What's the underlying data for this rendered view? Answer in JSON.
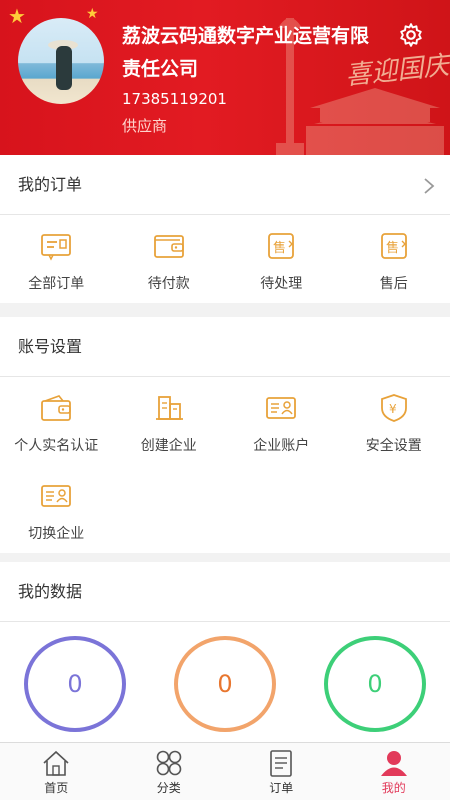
{
  "profile": {
    "company": "荔波云码通数字产业运营有限责任公司",
    "phone": "17385119201",
    "role": "供应商",
    "banner_text": "喜迎国庆"
  },
  "orders": {
    "title": "我的订单",
    "items": [
      {
        "label": "全部订单",
        "icon": "order-list-icon"
      },
      {
        "label": "待付款",
        "icon": "wallet-icon"
      },
      {
        "label": "待处理",
        "icon": "sell-pending-icon"
      },
      {
        "label": "售后",
        "icon": "after-sale-icon"
      }
    ]
  },
  "account": {
    "title": "账号设置",
    "items": [
      {
        "label": "个人实名认证",
        "icon": "wallet-id-icon"
      },
      {
        "label": "创建企业",
        "icon": "building-icon"
      },
      {
        "label": "企业账户",
        "icon": "id-card-icon"
      },
      {
        "label": "安全设置",
        "icon": "shield-yen-icon"
      },
      {
        "label": "切换企业",
        "icon": "id-card-icon"
      }
    ]
  },
  "my_data": {
    "title": "我的数据",
    "items": [
      {
        "value": "0",
        "color": "#7b74d8"
      },
      {
        "value": "0",
        "color": "#f2a46b"
      },
      {
        "value": "0",
        "color": "#3dcf78"
      }
    ]
  },
  "tabbar": {
    "items": [
      {
        "label": "首页",
        "icon": "home-icon"
      },
      {
        "label": "分类",
        "icon": "category-icon"
      },
      {
        "label": "订单",
        "icon": "order-icon"
      },
      {
        "label": "我的",
        "icon": "user-icon",
        "active": true
      }
    ]
  },
  "colors": {
    "header_red": "#d7131c",
    "accent_orange": "#e8a23a",
    "active_tab": "#e23a5a"
  }
}
